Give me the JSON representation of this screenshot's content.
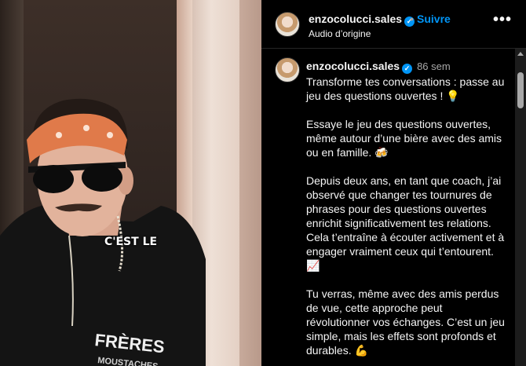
{
  "header": {
    "username": "enzocolucci.sales",
    "separator": "•",
    "follow_label": "Suivre",
    "audio_label": "Audio d’origine",
    "more_label": "•••"
  },
  "video": {
    "caption": "C'EST LE"
  },
  "comment": {
    "username": "enzocolucci.sales",
    "timestamp": "86 sem",
    "paragraphs": [
      "Transforme tes conversations : passe au jeu des questions ouvertes ! 💡",
      "Essaye le jeu des questions ouvertes, même autour d’une bière avec des amis ou en famille. 🍻",
      "Depuis deux ans, en tant que coach, j’ai observé que changer tes tournures de phrases pour des questions ouvertes enrichit significativement tes relations. Cela t’entraîne à écouter activement et à engager vraiment ceux qui t’entourent. 📈",
      "Tu verras, même avec des amis perdus de vue, cette approche peut révolutionner vos échanges. C’est un jeu simple, mais les effets sont profonds et durables. 💪"
    ]
  },
  "colors": {
    "accent": "#0095f6",
    "background": "#000000",
    "secondary_text": "#a8a8a8"
  }
}
